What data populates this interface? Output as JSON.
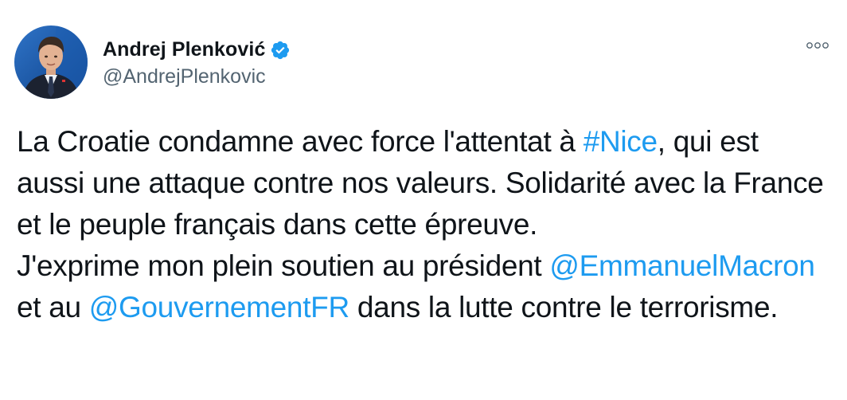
{
  "author": {
    "display_name": "Andrej Plenković",
    "handle": "@AndrejPlenkovic",
    "verified": true
  },
  "icons": {
    "avatar": "profile-photo",
    "verified": "verified-badge-icon",
    "more": "more-options-icon"
  },
  "colors": {
    "link": "#1d9bf0",
    "text": "#0f1419",
    "secondary": "#536471",
    "verified_badge": "#1d9bf0"
  },
  "tweet": {
    "segments": [
      {
        "text": "La Croatie condamne avec force l'attentat à ",
        "type": "text"
      },
      {
        "text": "#Nice",
        "type": "hashtag"
      },
      {
        "text": ", qui est aussi une attaque contre nos valeurs. Solidarité avec la France et le peuple français dans cette épreuve.",
        "type": "text"
      },
      {
        "text": "J'exprime mon plein soutien au président ",
        "type": "text"
      },
      {
        "text": "@EmmanuelMacron",
        "type": "mention"
      },
      {
        "text": " et au ",
        "type": "text"
      },
      {
        "text": "@GouvernementFR",
        "type": "mention"
      },
      {
        "text": " dans la lutte contre le terrorisme.",
        "type": "text"
      }
    ]
  }
}
